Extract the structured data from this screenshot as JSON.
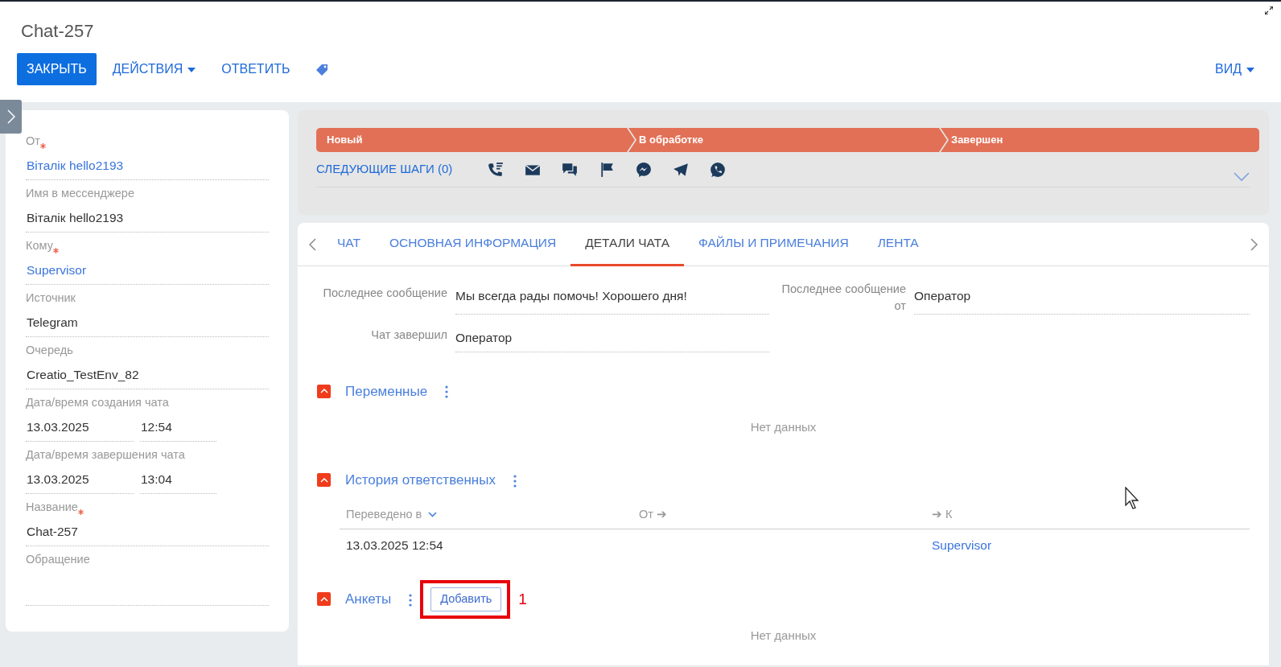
{
  "window": {
    "title": "Chat-257"
  },
  "toolbar": {
    "close": "ЗАКРЫТЬ",
    "actions": "ДЕЙСТВИЯ",
    "reply": "ОТВЕТИТЬ",
    "view": "ВИД"
  },
  "profile_fields": [
    {
      "kind": "link",
      "label": "От",
      "required": true,
      "value": "Віталік hello2193"
    },
    {
      "kind": "text",
      "label": "Имя в мессенджере",
      "required": false,
      "value": "Віталік hello2193"
    },
    {
      "kind": "link",
      "label": "Кому",
      "required": true,
      "value": "Supervisor"
    },
    {
      "kind": "text",
      "label": "Источник",
      "required": false,
      "value": "Telegram"
    },
    {
      "kind": "text",
      "label": "Очередь",
      "required": false,
      "value": "Creatio_TestEnv_82"
    },
    {
      "kind": "datetime",
      "label": "Дата/время создания чата",
      "required": false,
      "date": "13.03.2025",
      "time": "12:54"
    },
    {
      "kind": "datetime",
      "label": "Дата/время завершения чата",
      "required": false,
      "date": "13.03.2025",
      "time": "13:04"
    },
    {
      "kind": "text",
      "label": "Название",
      "required": true,
      "value": "Chat-257"
    },
    {
      "kind": "empty",
      "label": "Обращение",
      "required": false
    }
  ],
  "stages": [
    "Новый",
    "В обработке",
    "Завершен"
  ],
  "next_steps": "СЛЕДУЮЩИЕ ШАГИ (0)",
  "tabs": [
    {
      "label": "ЧАТ",
      "selected": false
    },
    {
      "label": "ОСНОВНАЯ ИНФОРМАЦИЯ",
      "selected": false
    },
    {
      "label": "ДЕТАЛИ ЧАТА",
      "selected": true
    },
    {
      "label": "ФАЙЛЫ И ПРИМЕЧАНИЯ",
      "selected": false
    },
    {
      "label": "ЛЕНТА",
      "selected": false
    }
  ],
  "details": [
    {
      "label": "Последнее сообщение",
      "value": "Мы всегда рады помочь! Хорошего дня!"
    },
    {
      "label": "Последнее сообщение от",
      "value": "Оператор"
    },
    {
      "label": "Чат завершил",
      "value": "Оператор"
    }
  ],
  "sections": [
    {
      "kind": "empty",
      "title": "Переменные",
      "expanded": true,
      "empty_text": "Нет данных"
    },
    {
      "kind": "table",
      "title": "История ответственных",
      "expanded": true,
      "columns": [
        "Переведено в",
        "От ➔",
        "➔ К"
      ],
      "rows": [
        [
          "13.03.2025 12:54",
          "",
          "Supervisor"
        ]
      ]
    },
    {
      "kind": "empty",
      "title": "Анкеты",
      "expanded": true,
      "add_button": "Добавить",
      "callout": "1",
      "empty_text": "Нет данных"
    }
  ]
}
